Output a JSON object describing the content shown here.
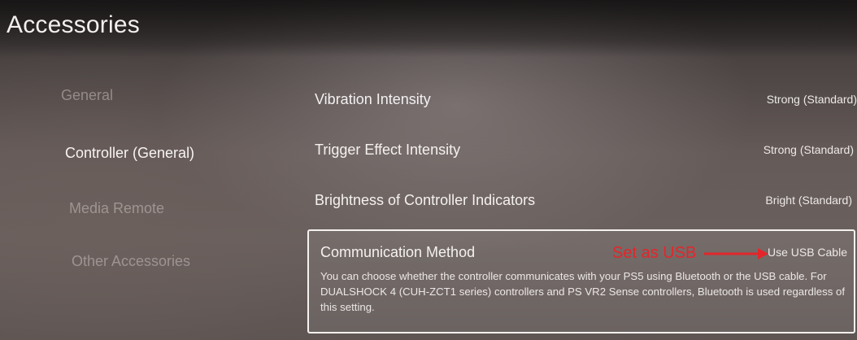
{
  "page": {
    "title": "Accessories"
  },
  "nav": {
    "items": [
      {
        "label": "General",
        "active": false
      },
      {
        "label": "Controller (General)",
        "active": true
      },
      {
        "label": "Media Remote",
        "active": false
      },
      {
        "label": "Other Accessories",
        "active": false
      }
    ]
  },
  "settings": [
    {
      "label": "Vibration Intensity",
      "value": "Strong (Standard)"
    },
    {
      "label": "Trigger Effect Intensity",
      "value": "Strong (Standard)"
    },
    {
      "label": "Brightness of Controller Indicators",
      "value": "Bright (Standard)"
    },
    {
      "label": "Communication Method",
      "value": "Use USB Cable",
      "description": "You can choose whether the controller communicates with your PS5 using Bluetooth or the USB cable. For DUALSHOCK 4 (CUH-ZCT1 series) controllers and PS VR2 Sense controllers, Bluetooth is used regardless of this setting."
    }
  ],
  "annotation": {
    "text": "Set as USB",
    "color": "#e3262b"
  }
}
